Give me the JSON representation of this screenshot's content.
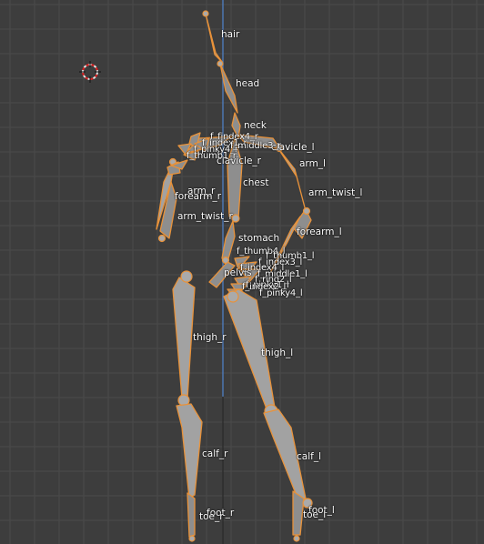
{
  "viewport": {
    "background": "#3d3d3d",
    "grid_color": "#4a4a4a",
    "axis_color": "#4f7fc4",
    "bone_outline": "#e8923a",
    "bone_fill": "#8e8e8e"
  },
  "bone_labels": {
    "hair": "hair",
    "head": "head",
    "neck": "neck",
    "clavicle_l": "clavicle_l",
    "clavicle_r": "clavicle_r",
    "arm_l": "arm_l",
    "arm_r": "arm_r",
    "arm_twist_l": "arm_twist_l",
    "arm_twist_r": "arm_twist_r",
    "forearm_l": "forearm_l",
    "forearm_r": "forearm_r",
    "chest": "chest",
    "stomach": "stomach",
    "pelvis": "pelvis",
    "thigh_l": "thigh_l",
    "thigh_r": "thigh_r",
    "calf_l": "calf_l",
    "calf_r": "calf_r",
    "foot_l": "foot_l",
    "foot_r": "foot_r",
    "toe_l": "toe_l",
    "toe_r": "toe_r",
    "hand_r_cluster": [
      "f_findex4_r",
      "f_index1_r",
      "f_pinky4_r",
      "f_thumb1_r",
      "f_middle3_r"
    ],
    "hand_l_cluster": [
      "f_thumb4_l",
      "f_thumb1_l",
      "f_index3_l",
      "f_index4_l",
      "f_middle1_l",
      "f_ring2_l",
      "f_pinky1_l",
      "f_index2_l",
      "f_pinky4_l"
    ]
  },
  "cursor": {
    "icon": "3d-cursor-icon"
  }
}
